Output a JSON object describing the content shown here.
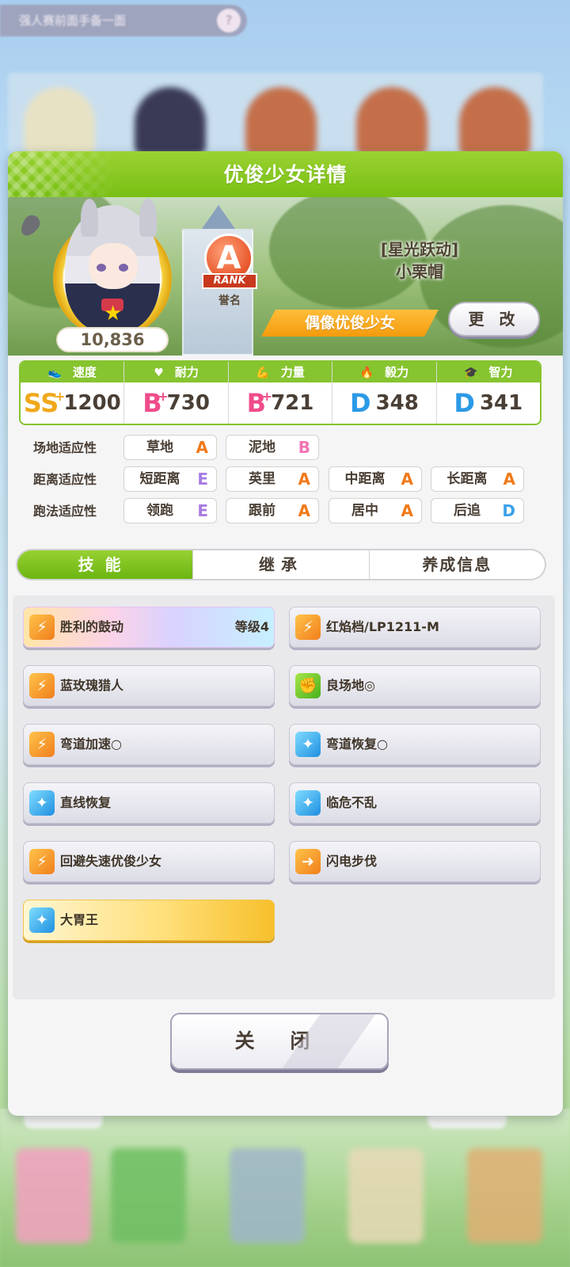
{
  "background": {
    "search_text": "强人赛前面手备一面",
    "search_button": "?"
  },
  "dialog": {
    "title": "优俊少女详情",
    "banner": {
      "fans": "10,836",
      "rank_letter": "A",
      "rank_word": "RANK",
      "rank_label": "誉名",
      "epithet": "[星光跃动]",
      "name": "小栗帽",
      "title_badge": "偶像优俊少女",
      "change_button": "更 改"
    },
    "stats": [
      {
        "name": "速度",
        "icon": "shoe-icon",
        "grade": "SS",
        "plus": "+",
        "value": "1200",
        "grade_color": "#f0a81a"
      },
      {
        "name": "耐力",
        "icon": "heart-icon",
        "grade": "B",
        "plus": "+",
        "value": "730",
        "grade_color": "#ef4c8a"
      },
      {
        "name": "力量",
        "icon": "muscle-icon",
        "grade": "B",
        "plus": "+",
        "value": "721",
        "grade_color": "#ef4c8a"
      },
      {
        "name": "毅力",
        "icon": "flame-icon",
        "grade": "D",
        "plus": "",
        "value": "348",
        "grade_color": "#2c9ae6"
      },
      {
        "name": "智力",
        "icon": "graduation-cap-icon",
        "grade": "D",
        "plus": "",
        "value": "341",
        "grade_color": "#2c9ae6"
      }
    ],
    "aptitude": {
      "track": {
        "label": "场地适应性",
        "items": [
          {
            "name": "草地",
            "grade": "A"
          },
          {
            "name": "泥地",
            "grade": "B"
          }
        ]
      },
      "distance": {
        "label": "距离适应性",
        "items": [
          {
            "name": "短距离",
            "grade": "E"
          },
          {
            "name": "英里",
            "grade": "A"
          },
          {
            "name": "中距离",
            "grade": "A"
          },
          {
            "name": "长距离",
            "grade": "A"
          }
        ]
      },
      "strategy": {
        "label": "跑法适应性",
        "items": [
          {
            "name": "领跑",
            "grade": "E"
          },
          {
            "name": "跟前",
            "grade": "A"
          },
          {
            "name": "居中",
            "grade": "A"
          },
          {
            "name": "后追",
            "grade": "D"
          }
        ]
      }
    },
    "tabs": [
      {
        "label": "技能",
        "active": true
      },
      {
        "label": "继承",
        "active": false
      },
      {
        "label": "养成信息",
        "active": false
      }
    ],
    "skills": [
      {
        "name": "胜利的鼓动",
        "level": "等级4",
        "icon": "running-speed-icon",
        "style": "rainbow"
      },
      {
        "name": "红焰档/LP1211-M",
        "level": "",
        "icon": "running-speed-icon",
        "style": "normal"
      },
      {
        "name": "蓝玫瑰猎人",
        "level": "",
        "icon": "running-speed-icon",
        "style": "normal"
      },
      {
        "name": "良场地◎",
        "level": "",
        "icon": "muscle-icon",
        "style": "normal"
      },
      {
        "name": "弯道加速○",
        "level": "",
        "icon": "running-speed-icon",
        "style": "normal"
      },
      {
        "name": "弯道恢复○",
        "level": "",
        "icon": "sparkle-recovery-icon",
        "style": "normal"
      },
      {
        "name": "直线恢复",
        "level": "",
        "icon": "sparkle-recovery-icon",
        "style": "normal"
      },
      {
        "name": "临危不乱",
        "level": "",
        "icon": "sparkle-recovery-icon",
        "style": "normal"
      },
      {
        "name": "回避失速优俊少女",
        "level": "",
        "icon": "running-speed-icon",
        "style": "normal"
      },
      {
        "name": "闪电步伐",
        "level": "",
        "icon": "lightning-step-icon",
        "style": "normal"
      },
      {
        "name": "大胃王",
        "level": "",
        "icon": "sparkle-recovery-icon",
        "style": "gold"
      }
    ],
    "close_button": "关 闭"
  }
}
